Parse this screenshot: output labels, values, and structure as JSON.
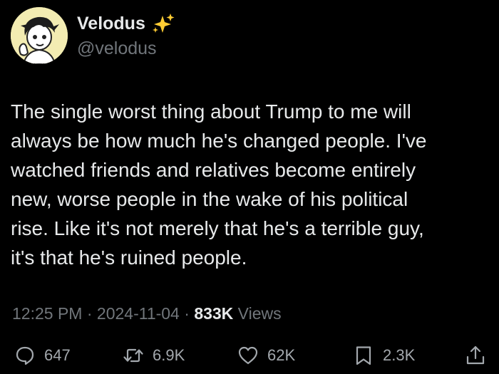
{
  "author": {
    "display_name": "Velodus",
    "handle": "@velodus",
    "badge_icon": "sparkles-icon",
    "badge_color": "#ffcc33"
  },
  "tweet": {
    "lines": [
      "The single worst thing about Trump to me will",
      "always be how much he's changed people. I've",
      "watched friends and relatives become entirely",
      "new, worse people in the wake of his political",
      "rise. Like it's not merely that he's a terrible guy,",
      "it's that he's ruined people."
    ]
  },
  "meta": {
    "time": "12:25 PM",
    "separator": " · ",
    "date": "2024-11-04",
    "views_count": "833K",
    "views_label": " Views"
  },
  "actions": {
    "reply": {
      "icon": "reply-icon",
      "count": "647"
    },
    "repost": {
      "icon": "repost-icon",
      "count": "6.9K"
    },
    "like": {
      "icon": "heart-icon",
      "count": "62K"
    },
    "bookmark": {
      "icon": "bookmark-icon",
      "count": "2.3K"
    },
    "share": {
      "icon": "share-icon"
    }
  },
  "colors": {
    "background": "#000000",
    "primary_text": "#e7e9ea",
    "secondary_text": "#71767b",
    "avatar_bg": "#f3ecb2"
  }
}
